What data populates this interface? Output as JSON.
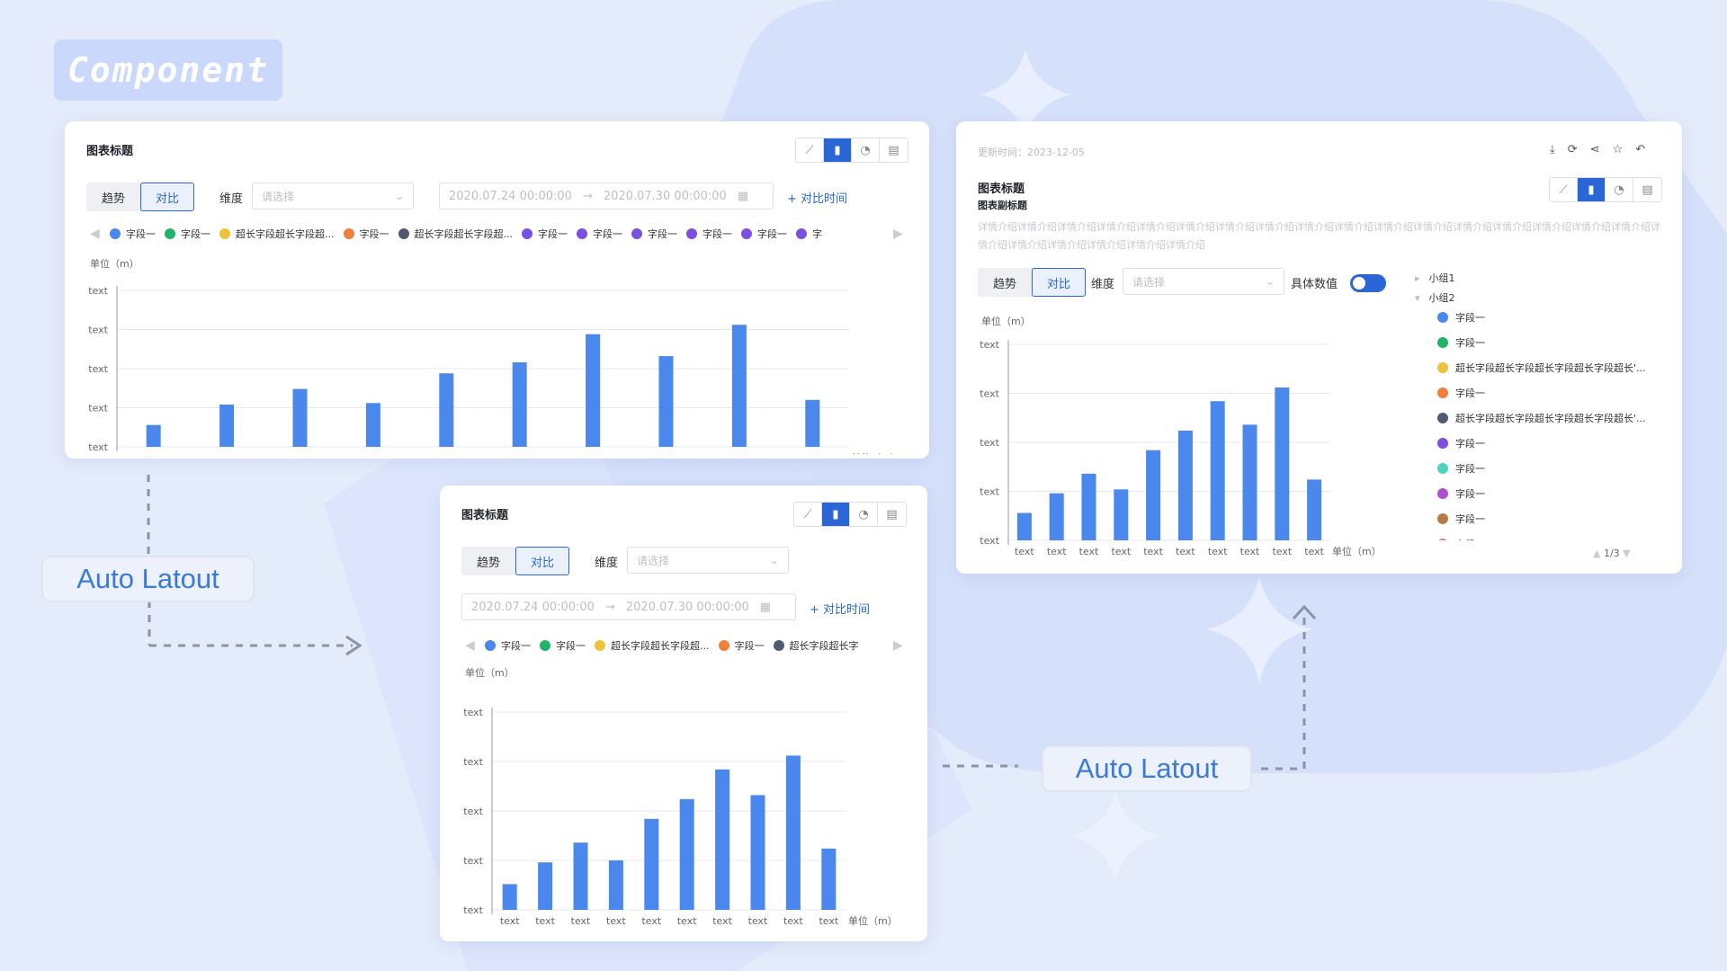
{
  "tag": "Component",
  "connectors": {
    "left_label": "Auto Latout",
    "right_label": "Auto Latout"
  },
  "common": {
    "title": "图表标题",
    "tab_trend": "趋势",
    "tab_compare": "对比",
    "dimension_label": "维度",
    "select_placeholder": "请选择",
    "date_start": "2020.07.24 00:00:00",
    "date_end": "2020.07.30 00:00:00",
    "date_arrow": "→",
    "add_compare": "+ 对比时间",
    "y_unit": "单位（m）",
    "x_unit": "单位（m）",
    "icons": [
      "line-chart-icon",
      "bar-chart-icon",
      "pie-chart-icon",
      "table-icon"
    ]
  },
  "card1": {
    "legend": [
      {
        "label": "字段一",
        "color": "#4a88ee"
      },
      {
        "label": "字段一",
        "color": "#22b36a"
      },
      {
        "label": "超长字段超长字段超...",
        "color": "#f0c23b"
      },
      {
        "label": "字段一",
        "color": "#f07f3c"
      },
      {
        "label": "超长字段超长字段超...",
        "color": "#4f5a73"
      },
      {
        "label": "字段一",
        "color": "#7b4fe0"
      },
      {
        "label": "字段一",
        "color": "#7b4fe0"
      },
      {
        "label": "字段一",
        "color": "#7b4fe0"
      },
      {
        "label": "字段一",
        "color": "#7b4fe0"
      },
      {
        "label": "字段一",
        "color": "#7b4fe0"
      },
      {
        "label": "字",
        "color": "#7b4fe0"
      }
    ]
  },
  "card2": {
    "legend": [
      {
        "label": "字段一",
        "color": "#4a88ee"
      },
      {
        "label": "字段一",
        "color": "#22b36a"
      },
      {
        "label": "超长字段超长字段超...",
        "color": "#f0c23b"
      },
      {
        "label": "字段一",
        "color": "#f07f3c"
      },
      {
        "label": "超长字段超长字",
        "color": "#4f5a73"
      }
    ]
  },
  "card3": {
    "update_time": "更新时间：2023-12-05",
    "subtitle": "图表副标题",
    "description": "详情介绍详情介绍详情介绍详情介绍详情介绍详情介绍详情介绍详情介绍详情介绍详情介绍详情介绍详情介绍详情介绍详情介绍详情介绍详情介绍详情介绍详情介绍详情介绍详情介绍详情介绍详情介绍详情介绍",
    "specific_value_label": "具体数值",
    "toggle_on": true,
    "top_icons": [
      "download-icon",
      "refresh-icon",
      "share-icon",
      "star-icon",
      "back-icon"
    ],
    "group1": "小组1",
    "group2": "小组2",
    "legend": [
      {
        "label": "字段一",
        "color": "#4a88ee"
      },
      {
        "label": "字段一",
        "color": "#22b36a"
      },
      {
        "label": "超长字段超长字段超长字段超长字段超长'...",
        "color": "#f0c23b"
      },
      {
        "label": "字段一",
        "color": "#f07f3c"
      },
      {
        "label": "超长字段超长字段超长字段超长字段超长'...",
        "color": "#4f5a73"
      },
      {
        "label": "字段一",
        "color": "#7b4fe0"
      },
      {
        "label": "字段一",
        "color": "#4dd4c0"
      },
      {
        "label": "字段一",
        "color": "#b04fd0"
      },
      {
        "label": "字段一",
        "color": "#b87a48"
      },
      {
        "label": "字段一",
        "color": "#f07a6a"
      }
    ],
    "pager": "1/3"
  },
  "chart_data": [
    {
      "type": "bar",
      "categories": [
        "text",
        "text",
        "text",
        "text",
        "text",
        "text",
        "text",
        "text",
        "text",
        "text"
      ],
      "values": [
        14,
        27,
        37,
        28,
        47,
        54,
        72,
        58,
        78,
        30
      ],
      "y_ticks": [
        "text",
        "text",
        "text",
        "text",
        "text"
      ],
      "ylim": [
        0,
        100
      ],
      "color": "#4a88ee"
    },
    {
      "type": "bar",
      "categories": [
        "text",
        "text",
        "text",
        "text",
        "text",
        "text",
        "text",
        "text",
        "text",
        "text"
      ],
      "values": [
        13,
        24,
        34,
        25,
        46,
        56,
        71,
        58,
        78,
        31
      ],
      "y_ticks": [
        "text",
        "text",
        "text",
        "text",
        "text"
      ],
      "ylim": [
        0,
        100
      ],
      "color": "#4a88ee"
    },
    {
      "type": "bar",
      "categories": [
        "text",
        "text",
        "text",
        "text",
        "text",
        "text",
        "text",
        "text",
        "text",
        "text"
      ],
      "values": [
        14,
        24,
        34,
        26,
        46,
        56,
        71,
        59,
        78,
        31
      ],
      "y_ticks": [
        "text",
        "text",
        "text",
        "text",
        "text"
      ],
      "ylim": [
        0,
        100
      ],
      "color": "#4a88ee"
    }
  ]
}
